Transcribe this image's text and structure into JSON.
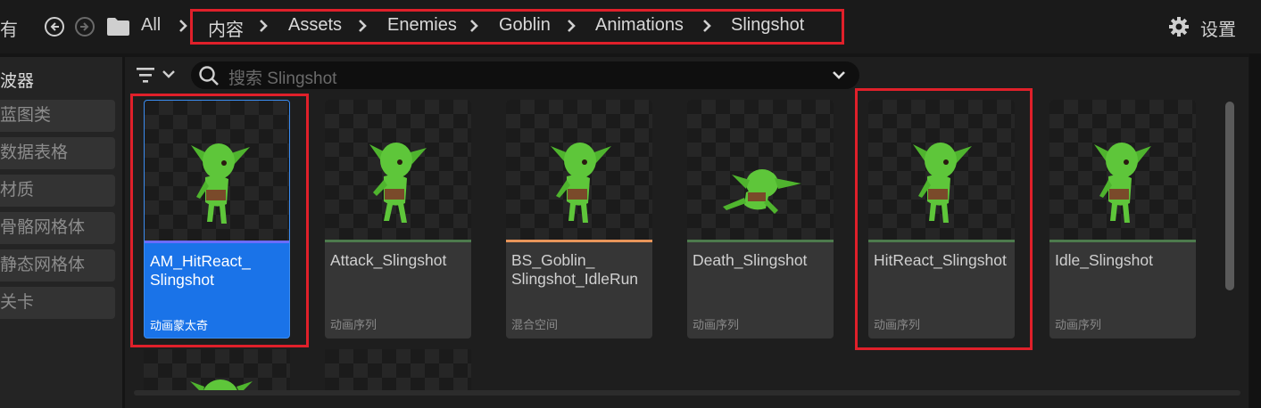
{
  "topbar": {
    "all_partial": "有",
    "all_label": "All",
    "breadcrumb": [
      "内容",
      "Assets",
      "Enemies",
      "Goblin",
      "Animations",
      "Slingshot"
    ],
    "settings_label": "设置"
  },
  "sidebar": {
    "title": "波器",
    "items": [
      "蓝图类",
      "数据表格",
      "材质",
      "骨骼网格体",
      "静态网格体",
      "关卡"
    ]
  },
  "search": {
    "placeholder": "搜索 Slingshot"
  },
  "assets": [
    {
      "name": "AM_HitReact_ Slingshot",
      "type": "动画蒙太奇",
      "bar_color": "#6b6bff",
      "selected": true
    },
    {
      "name": "Attack_Slingshot",
      "type": "动画序列",
      "bar_color": "#4d7a4d"
    },
    {
      "name": "BS_Goblin_ Slingshot_IdleRun",
      "type": "混合空间",
      "bar_color": "#e8955a"
    },
    {
      "name": "Death_Slingshot",
      "type": "动画序列",
      "bar_color": "#4d7a4d"
    },
    {
      "name": "HitReact_Slingshot",
      "type": "动画序列",
      "bar_color": "#4d7a4d"
    },
    {
      "name": "Idle_Slingshot",
      "type": "动画序列",
      "bar_color": "#4d7a4d"
    }
  ],
  "icons": [
    "back-icon",
    "forward-icon",
    "folder-icon",
    "chevron-right-icon",
    "gear-icon",
    "filter-icon",
    "search-icon",
    "chevron-down-icon"
  ],
  "colors": {
    "highlight": "#e0202a",
    "selection": "#1a73e8",
    "goblin": "#5ec63a"
  }
}
